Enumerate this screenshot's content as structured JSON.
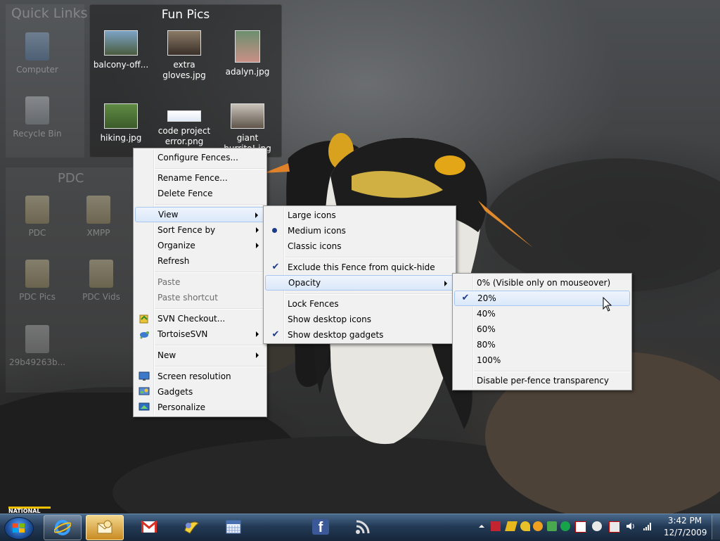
{
  "colors": {
    "menu_bg": "#f1f1f1",
    "highlight_border": "#a8c7ef",
    "check_color": "#1c3b8a",
    "taskbar": "#233a56"
  },
  "fences": {
    "quick_links": {
      "title": "Quick Links",
      "items": [
        {
          "label": "Computer",
          "icon": "computer-icon"
        },
        {
          "label": "Recycle Bin",
          "icon": "recycle-bin-icon"
        }
      ]
    },
    "fun_pics": {
      "title": "Fun Pics",
      "items": [
        {
          "label": "balcony-off..."
        },
        {
          "label": "extra gloves.jpg"
        },
        {
          "label": "adalyn.jpg"
        },
        {
          "label": "hiking.jpg"
        },
        {
          "label": "code project error.png"
        },
        {
          "label": "giant burrito!.jpg"
        }
      ]
    },
    "pdc": {
      "title": "PDC",
      "items": [
        {
          "label": "PDC"
        },
        {
          "label": "XMPP"
        },
        {
          "label": "PDC Pics"
        },
        {
          "label": "PDC Vids"
        },
        {
          "label": "29b49263b..."
        }
      ]
    }
  },
  "watermark": "NATIONAL",
  "context_menu": {
    "items": [
      {
        "label": "Configure Fences..."
      },
      {
        "label": "Rename Fence..."
      },
      {
        "label": "Delete Fence"
      },
      {
        "label": "View",
        "submenu": true
      },
      {
        "label": "Sort Fence by",
        "submenu": true
      },
      {
        "label": "Organize",
        "submenu": true
      },
      {
        "label": "Refresh"
      },
      {
        "label": "Paste",
        "disabled": true
      },
      {
        "label": "Paste shortcut",
        "disabled": true
      },
      {
        "label": "SVN Checkout...",
        "icon": "svn-checkout-icon"
      },
      {
        "label": "TortoiseSVN",
        "icon": "tortoise-icon",
        "submenu": true
      },
      {
        "label": "New",
        "submenu": true
      },
      {
        "label": "Screen resolution",
        "icon": "monitor-icon"
      },
      {
        "label": "Gadgets",
        "icon": "gadgets-icon"
      },
      {
        "label": "Personalize",
        "icon": "personalize-icon"
      }
    ]
  },
  "view_menu": {
    "items": [
      {
        "label": "Large icons"
      },
      {
        "label": "Medium icons",
        "selected": true
      },
      {
        "label": "Classic icons"
      },
      {
        "label": "Exclude this Fence from quick-hide",
        "checked": true
      },
      {
        "label": "Opacity",
        "submenu": true
      },
      {
        "label": "Lock Fences"
      },
      {
        "label": "Show desktop icons"
      },
      {
        "label": "Show desktop gadgets",
        "checked": true
      }
    ]
  },
  "opacity_menu": {
    "items": [
      {
        "label": "0% (Visible only on mouseover)"
      },
      {
        "label": "20%",
        "checked": true
      },
      {
        "label": "40%"
      },
      {
        "label": "60%"
      },
      {
        "label": "80%"
      },
      {
        "label": "100%"
      },
      {
        "label": "Disable per-fence transparency"
      }
    ]
  },
  "taskbar": {
    "start_icon": "windows-logo-icon",
    "buttons": [
      {
        "name": "internet-explorer",
        "icon": "ie-icon"
      },
      {
        "name": "outlook",
        "icon": "outlook-icon"
      },
      {
        "name": "gmail",
        "icon": "gmail-icon"
      },
      {
        "name": "pidgin",
        "icon": "pidgin-icon"
      },
      {
        "name": "calendar",
        "icon": "calendar-icon"
      },
      {
        "name": "facebook",
        "icon": "facebook-icon",
        "glyph": "f"
      },
      {
        "name": "rss",
        "icon": "rss-icon"
      }
    ],
    "clock": {
      "time": "3:42 PM",
      "date": "12/7/2009"
    }
  }
}
